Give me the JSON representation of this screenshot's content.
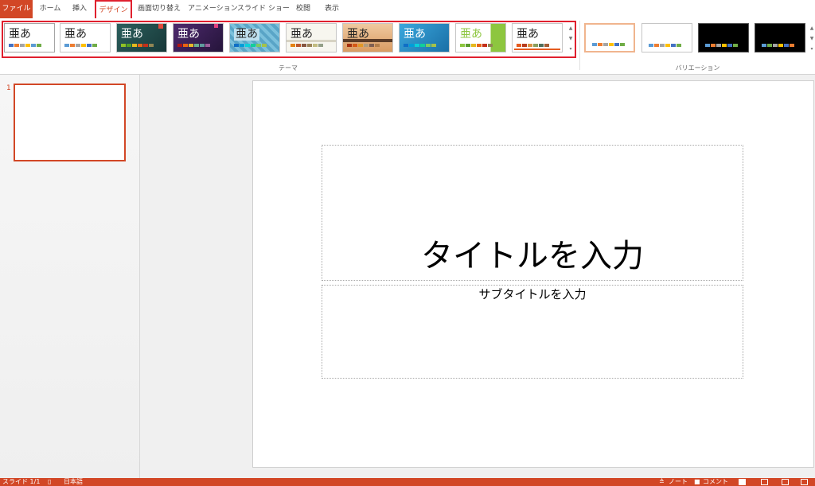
{
  "ribbon": {
    "tabs": [
      {
        "label": "ファイル"
      },
      {
        "label": "ホーム"
      },
      {
        "label": "挿入"
      },
      {
        "label": "デザイン"
      },
      {
        "label": "画面切り替え"
      },
      {
        "label": "アニメーション"
      },
      {
        "label": "スライド ショー"
      },
      {
        "label": "校閲"
      },
      {
        "label": "表示"
      }
    ],
    "themes_group_label": "テーマ",
    "variations_group_label": "バリエーション",
    "theme_sample_text": "亜あ",
    "scroll_up": "▲",
    "scroll_down": "▼",
    "scroll_more": "▾"
  },
  "themes": [
    {
      "name": "office-theme",
      "bg": "#ffffff",
      "text": "dark"
    },
    {
      "name": "office-theme-2",
      "bg": "#ffffff",
      "text": "dark"
    },
    {
      "name": "facet-theme",
      "bg": "#1f4e4e",
      "text": "light"
    },
    {
      "name": "ion-theme",
      "bg": "#3b2a5c",
      "text": "light"
    },
    {
      "name": "pattern-theme",
      "bg": "#6fb6d4",
      "text": "dark"
    },
    {
      "name": "retrospect-theme",
      "bg": "#f7f6ef",
      "text": "dark"
    },
    {
      "name": "wood-theme",
      "bg": "#e8b98a",
      "text": "dark"
    },
    {
      "name": "wisp-theme",
      "bg": "#2a8ec6",
      "text": "light"
    },
    {
      "name": "integral-theme",
      "bg": "#ffffff",
      "text": "green"
    },
    {
      "name": "organic-theme",
      "bg": "#ffffff",
      "text": "dark"
    }
  ],
  "variations": [
    {
      "name": "variation-1",
      "bg": "#ffffff"
    },
    {
      "name": "variation-2",
      "bg": "#ffffff"
    },
    {
      "name": "variation-3",
      "bg": "#000000"
    },
    {
      "name": "variation-4",
      "bg": "#000000"
    }
  ],
  "slides_pane": {
    "slide_number": "1"
  },
  "slide": {
    "title": "タイトルを入力",
    "subtitle": "サブタイトルを入力"
  },
  "status": {
    "slide_info": "スライド 1/1",
    "language": "日本語",
    "notes": "ノート",
    "comments": "コメント"
  },
  "colors": {
    "accent": "#d24726",
    "highlight": "#e0202e"
  }
}
